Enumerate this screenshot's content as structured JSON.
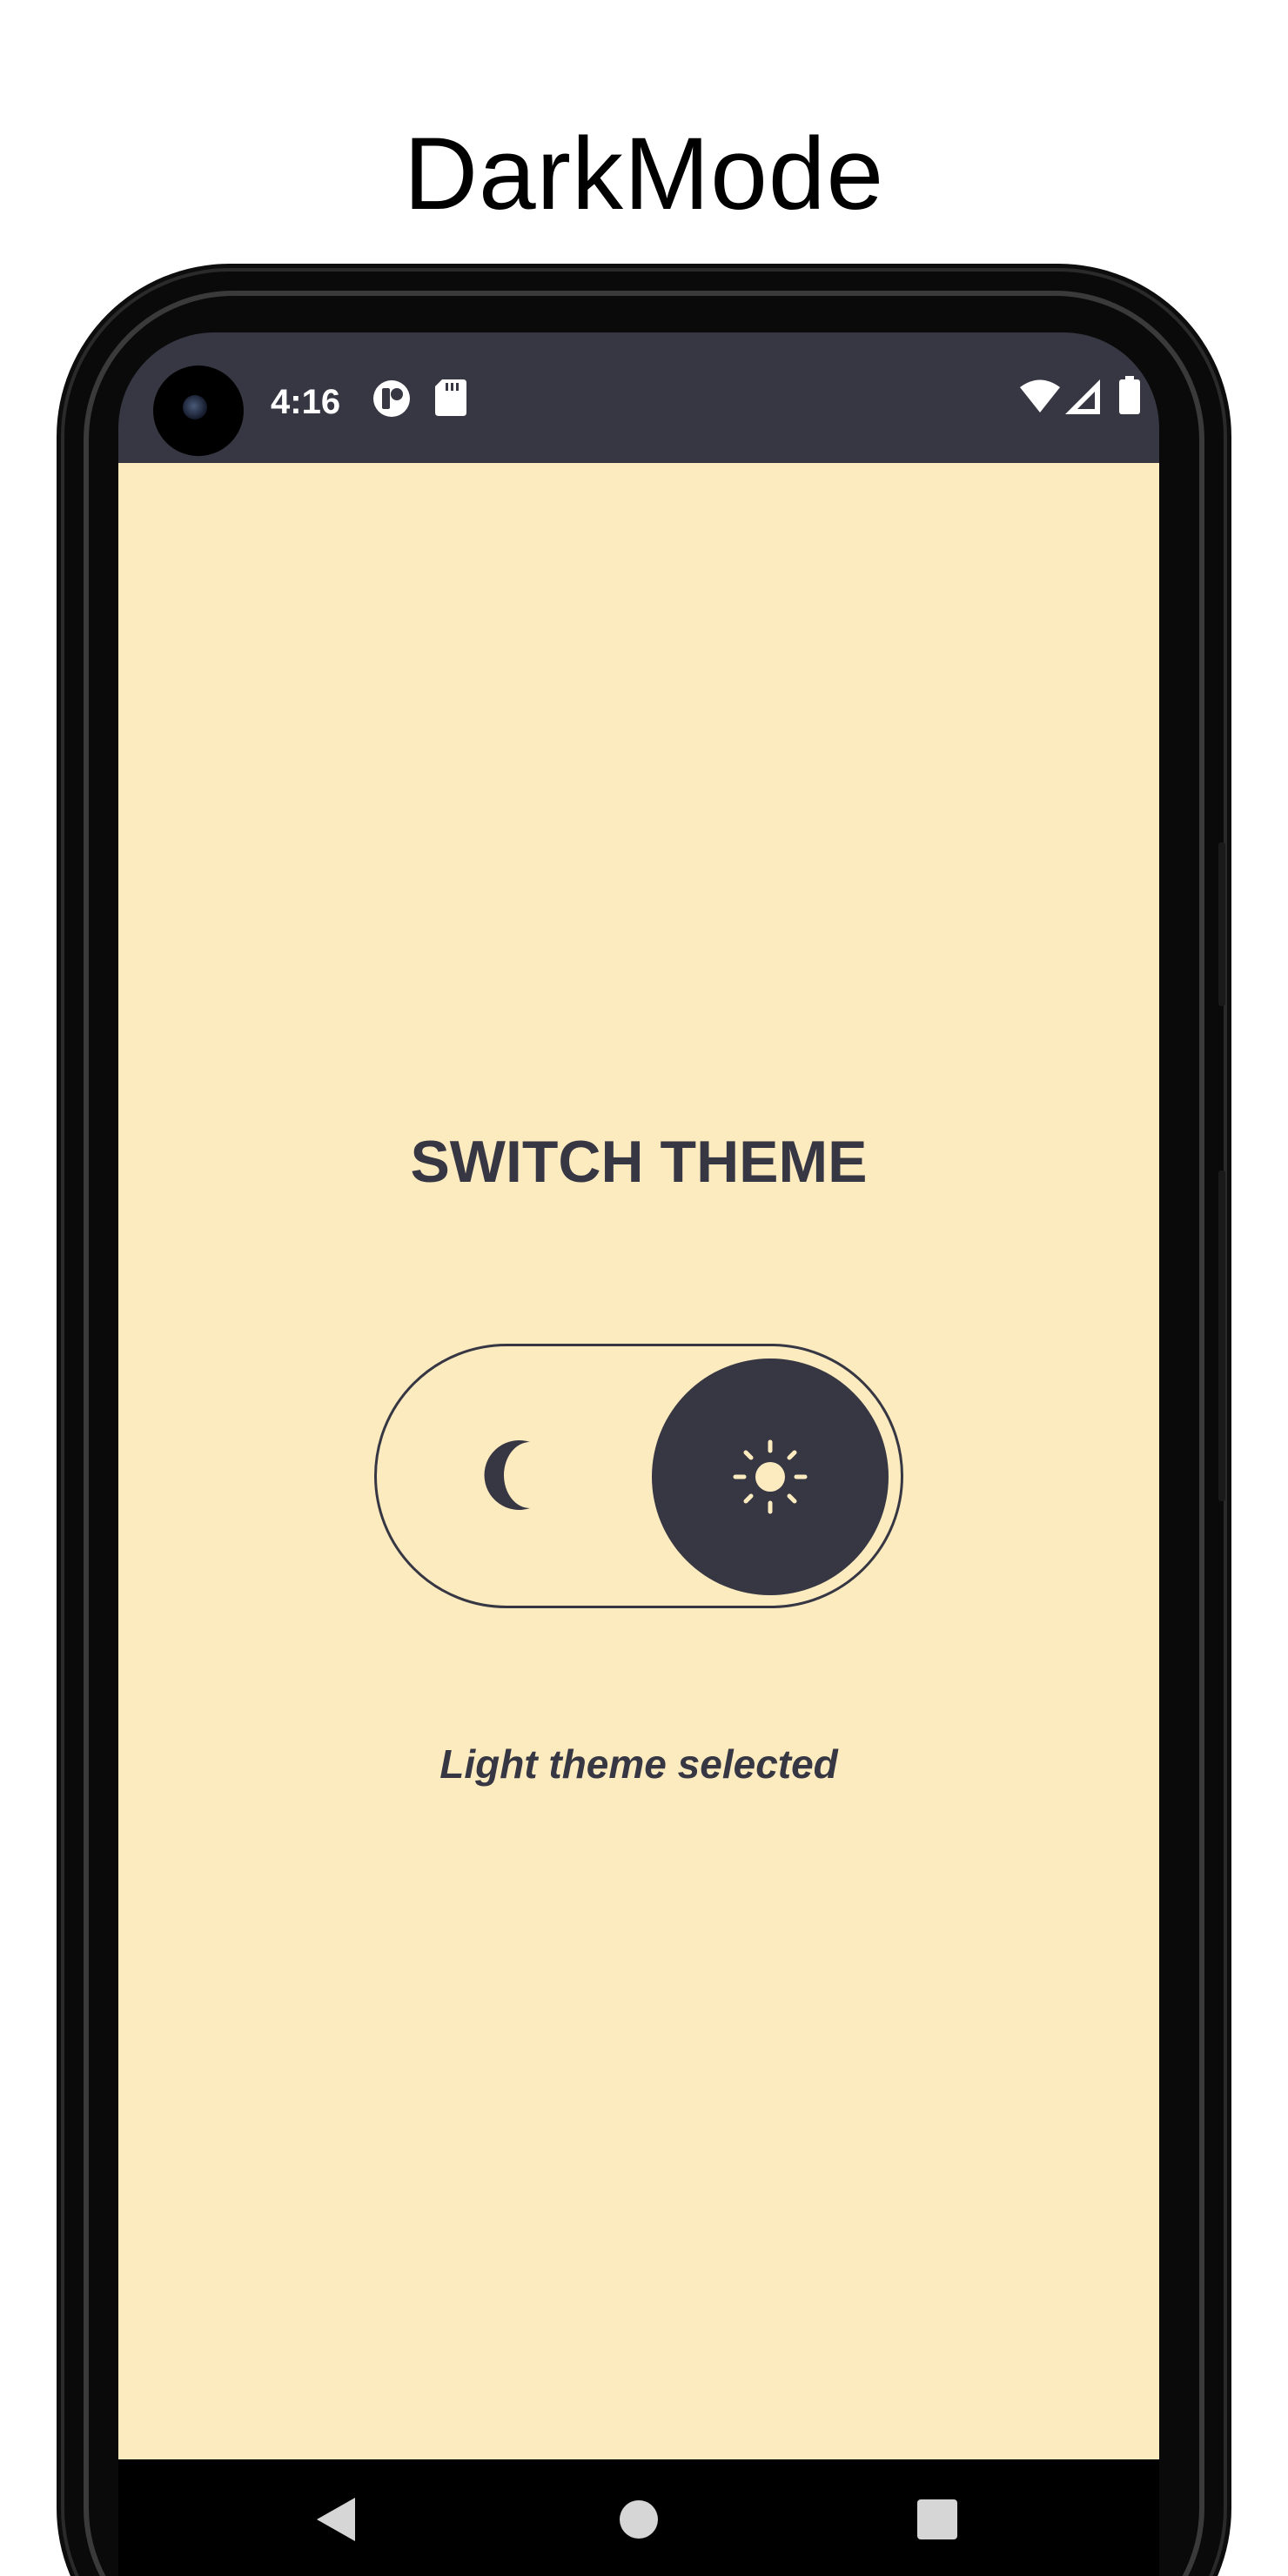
{
  "window": {
    "title": "DarkMode"
  },
  "status_bar": {
    "time": "4:16",
    "icons": [
      "notification-icon",
      "sd-card-icon",
      "wifi-icon",
      "signal-icon",
      "battery-icon"
    ]
  },
  "main": {
    "heading": "SWITCH THEME",
    "toggle": {
      "selected": "light",
      "left_icon": "moon-icon",
      "right_icon": "sun-icon"
    },
    "status_message": "Light theme selected"
  },
  "nav_bar": {
    "buttons": [
      "back-icon",
      "home-icon",
      "recents-icon"
    ]
  },
  "colors": {
    "background": "#fdebc0",
    "primary": "#363743",
    "accent": "#fdebc0",
    "status_bar": "#363743"
  }
}
